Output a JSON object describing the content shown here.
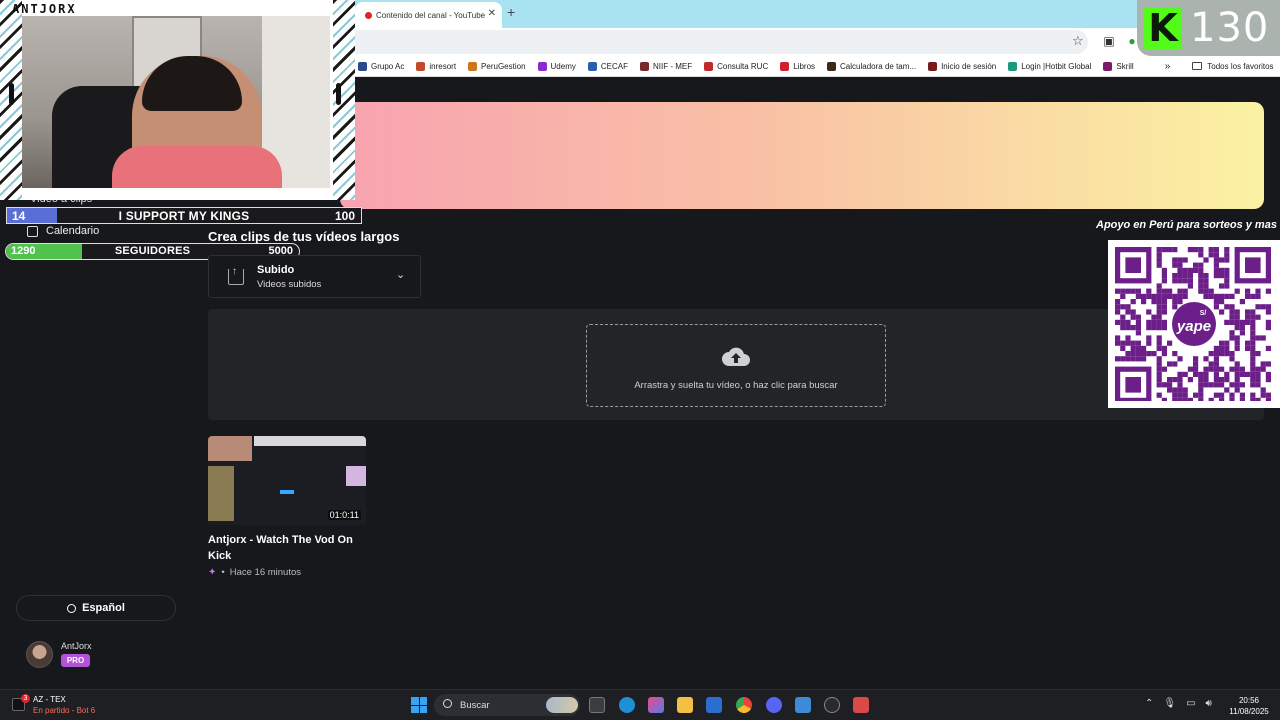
{
  "browser": {
    "tab_title": "Contenido del canal - YouTube",
    "new_tab_icon": "plus-icon",
    "bookmarks": [
      {
        "label": "Grupo Ac",
        "color": "#2b4a8c"
      },
      {
        "label": "inresort",
        "color": "#c24a2a"
      },
      {
        "label": "PeruGestion",
        "color": "#d0741a"
      },
      {
        "label": "Udemy",
        "color": "#8a2bd0"
      },
      {
        "label": "CECAF",
        "color": "#2a5fb0"
      },
      {
        "label": "NIIF - MEF",
        "color": "#7a2a2a"
      },
      {
        "label": "Consulta RUC",
        "color": "#c02a2a"
      },
      {
        "label": "Libros",
        "color": "#d0202a"
      },
      {
        "label": "Calculadora de tam...",
        "color": "#3a2a1a"
      },
      {
        "label": "Inicio de sesión",
        "color": "#7a1a1a"
      },
      {
        "label": "Login |Hotbit Global",
        "color": "#1a9a7a"
      },
      {
        "label": "Skrill",
        "color": "#7a1a6a"
      }
    ],
    "bookmarks_more": "»",
    "all_bookmarks": "Todos los favoritos"
  },
  "overlay": {
    "streamer_name": "ANTJORX",
    "kick_logo": "K",
    "kick_count": "130",
    "goal_support": {
      "current": "14",
      "label": "I SUPPORT MY KINGS",
      "max": "100",
      "progress": 0.14,
      "color": "#5a6fd6"
    },
    "goal_followers": {
      "current": "1290",
      "label": "SEGUIDORES",
      "max": "5000",
      "progress": 0.258,
      "color": "#52c24e"
    },
    "qr_caption": "Apoyo en Perú para sorteos y mas",
    "qr_center_label": "yape",
    "qr_currency": "S/"
  },
  "sidebar": {
    "items": [
      {
        "label": "Video a clips"
      },
      {
        "label": "Calendario"
      }
    ],
    "language": "Español",
    "user": {
      "name": "AntJorx",
      "badge": "PRO"
    }
  },
  "main": {
    "heading": "Crea clips de tus vídeos largos",
    "upload_select": {
      "title": "Subido",
      "subtitle": "Videos subidos"
    },
    "dropzone_text": "Arrastra y suelta tu vídeo, o haz clic para buscar",
    "video": {
      "duration": "01:0:11",
      "title": "Antjorx - Watch The Vod On Kick",
      "meta_separator": "•",
      "time_ago": "Hace 16 minutos"
    }
  },
  "taskbar": {
    "game_title": "AZ - TEX",
    "game_status": "En partido - Bot 6",
    "game_badge": "3",
    "search_placeholder": "Buscar",
    "time": "20:56",
    "date": "11/08/2025"
  },
  "colors": {
    "background": "#17181b",
    "kick_green": "#53fc18",
    "accent_purple": "#b452d8",
    "yape_purple": "#6c1e89"
  }
}
